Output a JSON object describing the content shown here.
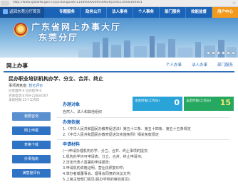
{
  "browser": {
    "url": "http://www.gdzwfw.gov.cn/portal/guide/11440000006939836J344114000300401"
  },
  "topnav": {
    "left_label": "返回东莞分厅首页",
    "menu": [
      "专题服务",
      "政务公开",
      "法人事务",
      "个人事务",
      "部门服务",
      "效能监督"
    ],
    "user_label": "用户中心"
  },
  "banner": {
    "title_line1": "广东省网上办事大厅",
    "title_line2": "东莞分厅"
  },
  "titlebar": {
    "heading": "网上办事",
    "links": [
      "个人办事",
      "法人办事",
      "部门服务"
    ]
  },
  "item": {
    "name": "民办职业培训机构办学、分立、合并、终止",
    "rating_label": "事项满意度:",
    "rating_value": "暂无评价",
    "info_lines": [
      "已受理件:0  已办结件:0",
      "咨询电话:0769-22834567",
      "承诺时限:15个工作日"
    ]
  },
  "left_buttons": [
    {
      "label": "我要咨询"
    },
    {
      "label": "网上申报"
    },
    {
      "label": "表格下载"
    },
    {
      "label": "办事指南"
    },
    {
      "label": "满意度评价"
    }
  ],
  "content": {
    "basic_header": "办理对象",
    "basic_line": "自然人、法人和其他组织",
    "stats": [
      {
        "label": "承诺时限(工作日)",
        "value": "0"
      },
      {
        "label": "法定时限(工作日)",
        "value": "15"
      }
    ],
    "basis_header": "办理依据",
    "basis_lines": [
      "1.《中华人民共和国民办教育促进法》第五十三条、第五十四条、第五十五条规定",
      "2.《中华人民共和国民办教育促进法实施条例》相关条款规定"
    ],
    "material_header": "申请材料",
    "material_lines": [
      "(一)申请办理机构办学、分立、合并、终止事项的提交:",
      "1.机构办学许可申请表、分立、合并、终止申请书;",
      "2.法定代表人签署的申请报告;",
      "3.申请机构资格证明、营业执照复印件;",
      "4.举办者或董事会、理事会同意的决议文件;",
      "5.上级主管部门意见(民办学校的审批意见);"
    ]
  }
}
